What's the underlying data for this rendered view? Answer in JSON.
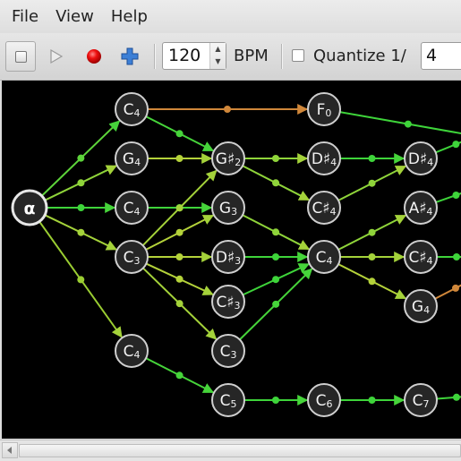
{
  "menu": {
    "items": [
      {
        "label": "File"
      },
      {
        "label": "View"
      },
      {
        "label": "Help"
      }
    ]
  },
  "toolbar": {
    "stop_icon": "stop-icon",
    "play_icon": "play-icon",
    "record_icon": "record-icon",
    "add_icon": "add-icon",
    "bpm_value": "120",
    "bpm_label": "BPM",
    "quantize_checked": false,
    "quantize_label": "Quantize 1/",
    "quantize_value": "4"
  },
  "graph": {
    "root": {
      "id": "alpha",
      "label": "α"
    },
    "nodes": [
      {
        "id": "n1",
        "note": "C",
        "octave": "4"
      },
      {
        "id": "n2",
        "note": "G",
        "octave": "4"
      },
      {
        "id": "n3",
        "note": "C",
        "octave": "4"
      },
      {
        "id": "n4",
        "note": "C",
        "octave": "3"
      },
      {
        "id": "n5",
        "note": "C",
        "octave": "4"
      },
      {
        "id": "n6",
        "note": "G♯",
        "octave": "2"
      },
      {
        "id": "n7",
        "note": "G",
        "octave": "3"
      },
      {
        "id": "n8",
        "note": "D♯",
        "octave": "3"
      },
      {
        "id": "n9",
        "note": "C♯",
        "octave": "3"
      },
      {
        "id": "n10",
        "note": "C",
        "octave": "3"
      },
      {
        "id": "n11",
        "note": "C",
        "octave": "5"
      },
      {
        "id": "n12",
        "note": "F",
        "octave": "0"
      },
      {
        "id": "n13",
        "note": "D♯",
        "octave": "4"
      },
      {
        "id": "n14",
        "note": "C♯",
        "octave": "4"
      },
      {
        "id": "n15",
        "note": "C",
        "octave": "4"
      },
      {
        "id": "n16",
        "note": "C",
        "octave": "6"
      },
      {
        "id": "n17",
        "note": "D♯",
        "octave": "4"
      },
      {
        "id": "n18",
        "note": "A♯",
        "octave": "4"
      },
      {
        "id": "n19",
        "note": "C♯",
        "octave": "4"
      },
      {
        "id": "n20",
        "note": "G",
        "octave": "4"
      },
      {
        "id": "n21",
        "note": "C",
        "octave": "7"
      }
    ],
    "edges": [
      {
        "from": "alpha",
        "to": "n1",
        "color": "#5dd43a"
      },
      {
        "from": "alpha",
        "to": "n2",
        "color": "#8fd43a"
      },
      {
        "from": "alpha",
        "to": "n3",
        "color": "#3ed43a"
      },
      {
        "from": "alpha",
        "to": "n4",
        "color": "#a4d23a"
      },
      {
        "from": "alpha",
        "to": "n5",
        "color": "#9acd32"
      },
      {
        "from": "n1",
        "to": "n12",
        "color": "#d0873a"
      },
      {
        "from": "n1",
        "to": "n6",
        "color": "#46d43a"
      },
      {
        "from": "n2",
        "to": "n6",
        "color": "#b4d23a"
      },
      {
        "from": "n3",
        "to": "n7",
        "color": "#3ed43a"
      },
      {
        "from": "n4",
        "to": "n6",
        "color": "#a4d23a"
      },
      {
        "from": "n4",
        "to": "n7",
        "color": "#b4d23a"
      },
      {
        "from": "n4",
        "to": "n8",
        "color": "#b4d23a"
      },
      {
        "from": "n4",
        "to": "n9",
        "color": "#b4d23a"
      },
      {
        "from": "n4",
        "to": "n10",
        "color": "#a4d23a"
      },
      {
        "from": "n5",
        "to": "n11",
        "color": "#46d43a"
      },
      {
        "from": "n6",
        "to": "n13",
        "color": "#8fd43a"
      },
      {
        "from": "n6",
        "to": "n14",
        "color": "#8fd43a"
      },
      {
        "from": "n7",
        "to": "n15",
        "color": "#8fd43a"
      },
      {
        "from": "n8",
        "to": "n15",
        "color": "#3ed43a"
      },
      {
        "from": "n9",
        "to": "n15",
        "color": "#3ed43a"
      },
      {
        "from": "n10",
        "to": "n15",
        "color": "#46d43a"
      },
      {
        "from": "n11",
        "to": "n16",
        "color": "#3ed43a"
      },
      {
        "from": "n12",
        "to": "off-top",
        "color": "#3ed43a"
      },
      {
        "from": "n13",
        "to": "n17",
        "color": "#3ed43a"
      },
      {
        "from": "n14",
        "to": "n17",
        "color": "#8fd43a"
      },
      {
        "from": "n15",
        "to": "n18",
        "color": "#8fd43a"
      },
      {
        "from": "n15",
        "to": "n19",
        "color": "#a4d23a"
      },
      {
        "from": "n15",
        "to": "n20",
        "color": "#b4d23a"
      },
      {
        "from": "n16",
        "to": "n21",
        "color": "#3ed43a"
      },
      {
        "from": "n17",
        "to": "off-top",
        "color": "#3ed43a"
      },
      {
        "from": "n18",
        "to": "off-right",
        "color": "#3ed43a"
      },
      {
        "from": "n19",
        "to": "off-right",
        "color": "#3ed43a"
      },
      {
        "from": "n20",
        "to": "off-right",
        "color": "#d0873a"
      },
      {
        "from": "n21",
        "to": "off-right",
        "color": "#3ed43a"
      }
    ]
  },
  "scrollbar": {
    "left_arrow_icon": "chevron-left-icon"
  }
}
